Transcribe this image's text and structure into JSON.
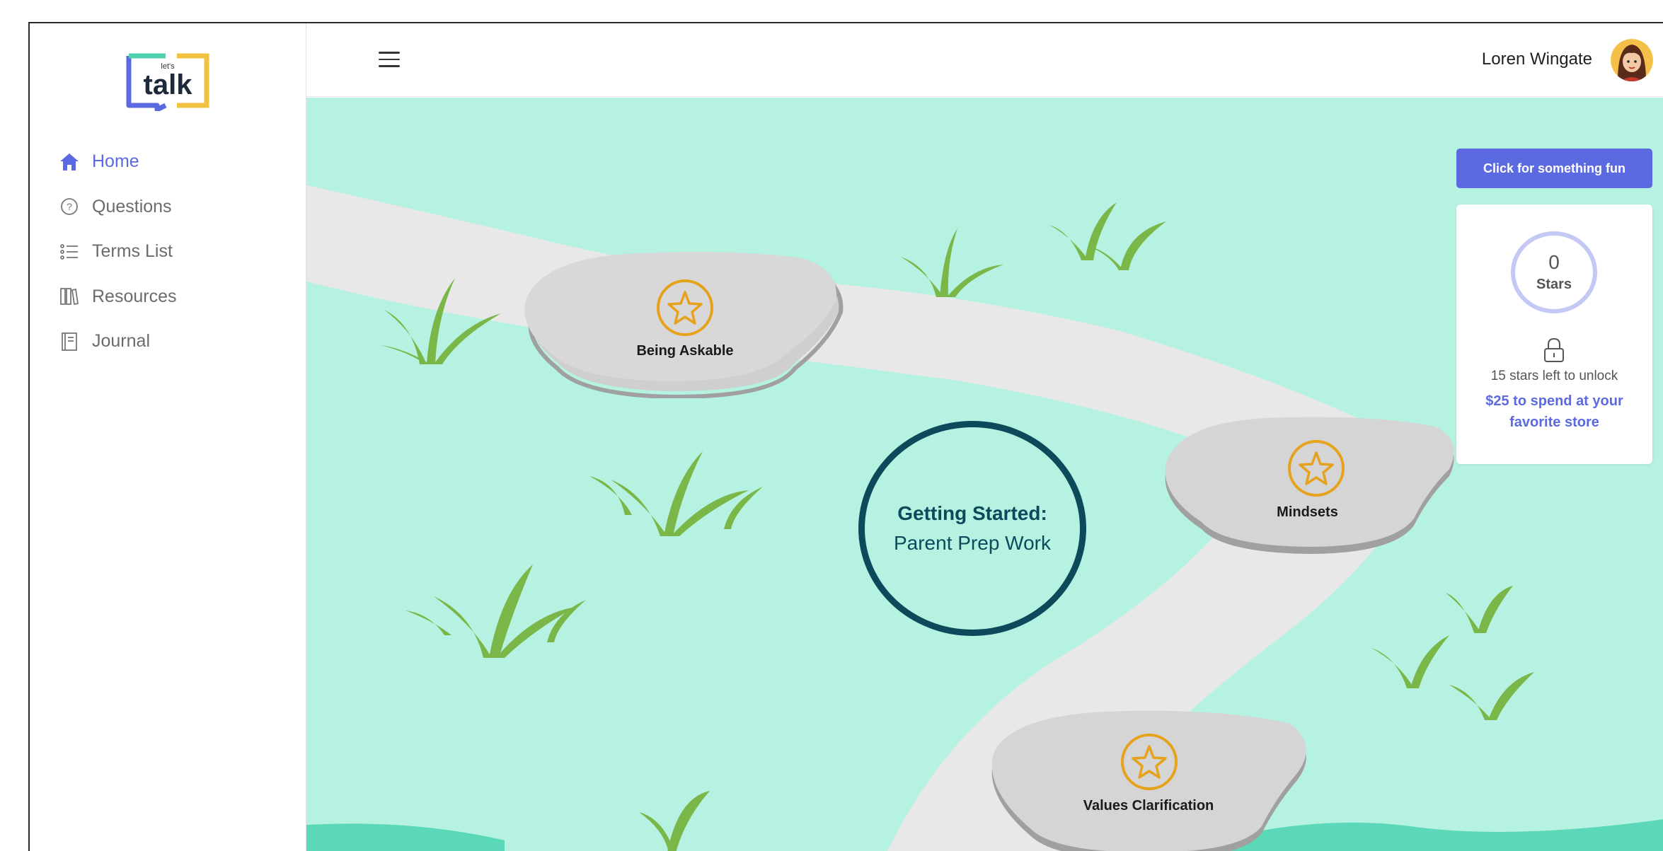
{
  "app": {
    "logo_small_text": "let's",
    "logo_text": "talk"
  },
  "sidebar": {
    "items": [
      {
        "label": "Home",
        "icon": "home-icon",
        "active": true
      },
      {
        "label": "Questions",
        "icon": "question-circle-icon",
        "active": false
      },
      {
        "label": "Terms List",
        "icon": "list-icon",
        "active": false
      },
      {
        "label": "Resources",
        "icon": "books-icon",
        "active": false
      },
      {
        "label": "Journal",
        "icon": "journal-icon",
        "active": false
      }
    ]
  },
  "header": {
    "menu_icon": "hamburger-icon",
    "user_name": "Loren Wingate"
  },
  "path": {
    "center_title": "Getting Started:",
    "center_subtitle": "Parent Prep Work",
    "stones": [
      {
        "label": "Being Askable",
        "icon": "star-icon"
      },
      {
        "label": "Mindsets",
        "icon": "star-icon"
      },
      {
        "label": "Values Clarification",
        "icon": "star-icon"
      }
    ]
  },
  "rewards": {
    "fun_button_label": "Click for something fun",
    "stars_count": "0",
    "stars_label": "Stars",
    "unlock_text": "15 stars left to unlock",
    "reward_text": "$25 to spend at your favorite store"
  },
  "colors": {
    "accent": "#5b6ae0",
    "scene_bg": "#b5f2e1",
    "path": "#e8e8e8",
    "dark_teal": "#0c4a5b",
    "star_gold": "#e6a21a",
    "grass": "#7ab648"
  }
}
